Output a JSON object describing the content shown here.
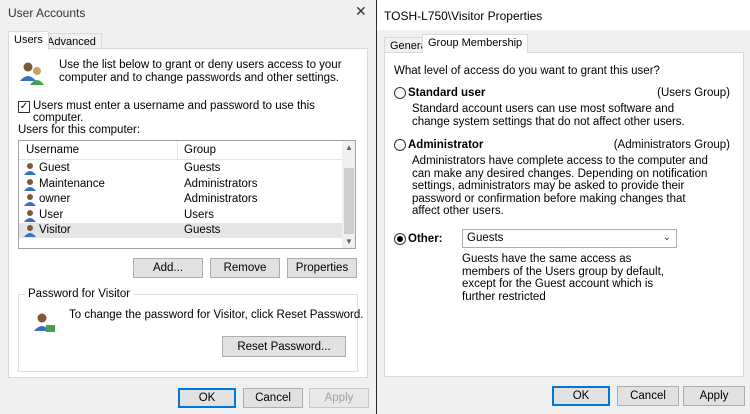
{
  "left_window": {
    "title": "User Accounts",
    "tabs": [
      {
        "label": "Users",
        "active": true
      },
      {
        "label": "Advanced",
        "active": false
      }
    ],
    "intro_text": "Use the list below to grant or deny users access to your computer and to change passwords and other settings.",
    "must_login_label": "Users must enter a username and password to use this computer.",
    "must_login_checked": true,
    "users_label": "Users for this computer:",
    "table": {
      "headers": [
        "Username",
        "Group"
      ],
      "rows": [
        {
          "username": "Guest",
          "group": "Guests"
        },
        {
          "username": "Maintenance",
          "group": "Administrators"
        },
        {
          "username": "owner",
          "group": "Administrators"
        },
        {
          "username": "User",
          "group": "Users"
        },
        {
          "username": "Visitor",
          "group": "Guests"
        }
      ],
      "selected_index": 4
    },
    "buttons": {
      "add": "Add...",
      "remove": "Remove",
      "properties": "Properties"
    },
    "password_group_label": "Password for Visitor",
    "password_text": "To change the password for Visitor, click Reset Password.",
    "reset_password_label": "Reset Password...",
    "footer": {
      "ok": "OK",
      "cancel": "Cancel",
      "apply": "Apply"
    }
  },
  "right_window": {
    "title": "TOSH-L750\\Visitor Properties",
    "tabs": [
      {
        "label": "General",
        "active": false
      },
      {
        "label": "Group Membership",
        "active": true
      }
    ],
    "question": "What level of access do you want to grant this user?",
    "options": [
      {
        "label": "Standard user",
        "group": "(Users Group)",
        "description": "Standard account users can use most software and change system settings that do not affect other users.",
        "selected": false
      },
      {
        "label": "Administrator",
        "group": "(Administrators Group)",
        "description": "Administrators have complete access to the computer and can make any desired changes. Depending on notification settings, administrators may be asked to provide their password or confirmation before making changes that affect other users.",
        "selected": false
      },
      {
        "label": "Other:",
        "selected": true
      }
    ],
    "other_select_value": "Guests",
    "other_description": "Guests have the same access as members of the Users group by default, except for the Guest account which is further restricted",
    "footer": {
      "ok": "OK",
      "cancel": "Cancel",
      "apply": "Apply"
    }
  },
  "colors": {
    "accent": "#0078d7",
    "window_bg": "#f0f0f0",
    "selected_row": "#e5e5e5"
  }
}
